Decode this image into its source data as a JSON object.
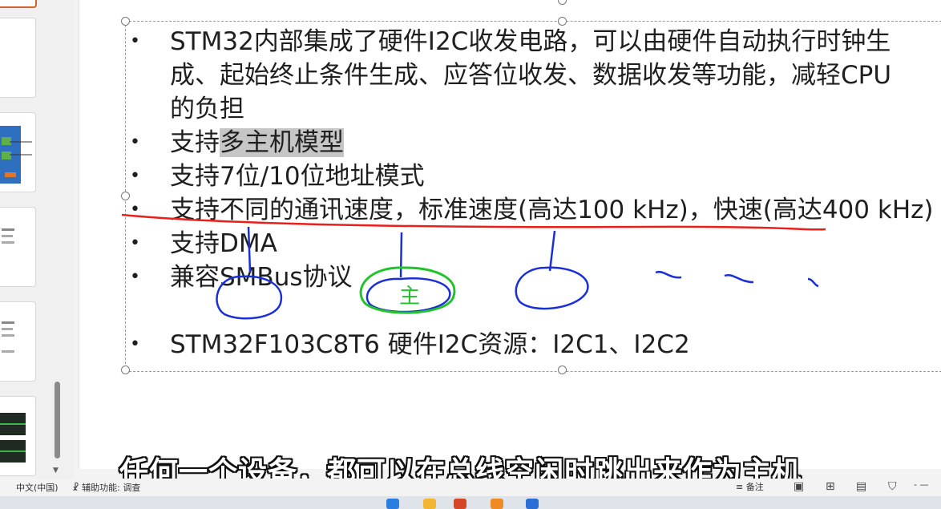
{
  "slide": {
    "bullets": [
      {
        "line1": "STM32内部集成了硬件I2C收发电路，可以由硬件自动执行时钟生",
        "line2": "成、起始终止条件生成、应答位收发、数据收发等功能，减轻CPU",
        "line3": "的负担"
      },
      {
        "prefix": "支持",
        "highlight": "多主机模型"
      },
      {
        "text": "支持7位/10位地址模式"
      },
      {
        "text": "支持不同的通讯速度，标准速度(高达100 kHz)，快速(高达400 kHz)"
      },
      {
        "text": "支持DMA"
      },
      {
        "text": "兼容SMBus协议"
      },
      {
        "text": "STM32F103C8T6 硬件I2C资源：I2C1、I2C2"
      }
    ],
    "bullet_glyph": "•",
    "annotation_text": "主"
  },
  "subtitle": "任何一个设备，都可以在总线空闲时跳出来作为主机",
  "statusbar": {
    "language": "中文(中国)",
    "accessibility": "辅助功能: 调查",
    "notes": "备注"
  },
  "colors": {
    "ink_red": "#e8201c",
    "ink_blue": "#1a2fd6",
    "ink_green": "#22c22a",
    "accent": "#d0632f"
  },
  "icons": [
    "accessibility-icon",
    "notes-icon",
    "normal-view-icon",
    "slide-sorter-icon",
    "reading-view-icon",
    "slideshow-icon"
  ]
}
